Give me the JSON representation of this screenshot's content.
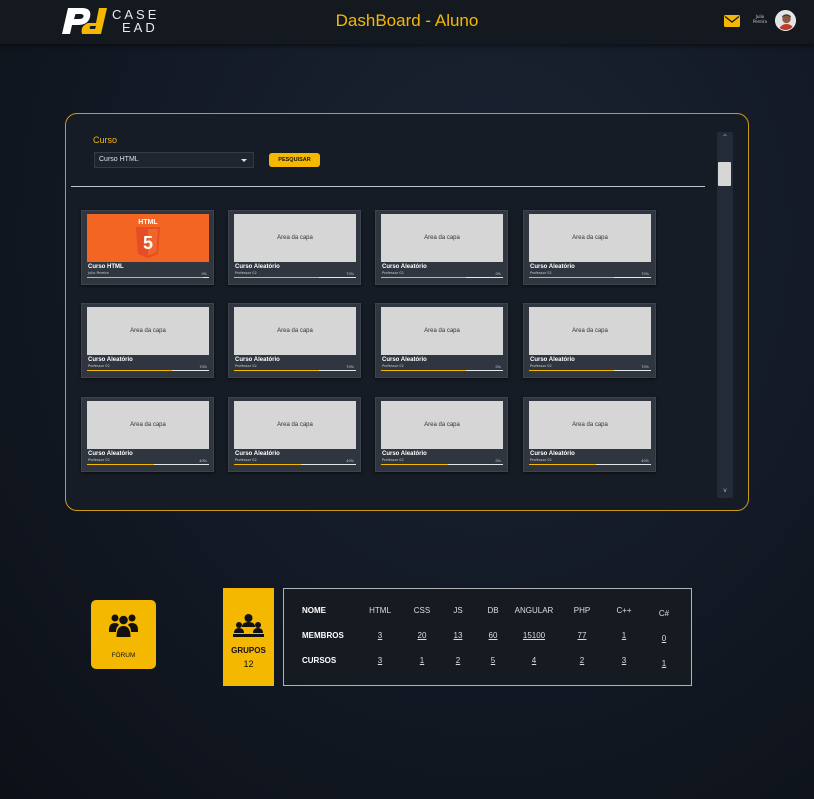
{
  "header": {
    "logo_text_line1": "CASE",
    "logo_text_line2": "EAD",
    "title": "DashBoard - Aluno",
    "user_name_line1": "Julio",
    "user_name_line2": "Pereira",
    "accent_color": "#f5b800"
  },
  "course_panel": {
    "label": "Curso",
    "select_value": "Curso HTML",
    "search_label": "PESQUISAR",
    "scroll_up": "^",
    "scroll_down": "v",
    "cards": [
      {
        "cover": "HTML",
        "title": "Curso HTML",
        "teacher": "Julio Pereira",
        "pct": "0%",
        "progress": 0.95
      },
      {
        "cover": "Area da capa",
        "title": "Curso Aleatório",
        "teacher": "Professor 02",
        "pct": "70%",
        "progress": 0.7
      },
      {
        "cover": "Area da capa",
        "title": "Curso Aleatório",
        "teacher": "Professor 02",
        "pct": "0%",
        "progress": 0.7
      },
      {
        "cover": "Area da capa",
        "title": "Curso Aleatório",
        "teacher": "Professor 02",
        "pct": "70%",
        "progress": 0.7
      },
      {
        "cover": "Area da capa",
        "title": "Curso Aleatório",
        "teacher": "Professor 02",
        "pct": "70%",
        "progress": 0.7
      },
      {
        "cover": "Area da capa",
        "title": "Curso Aleatório",
        "teacher": "Professor 02",
        "pct": "70%",
        "progress": 0.7
      },
      {
        "cover": "Area da capa",
        "title": "Curso Aleatório",
        "teacher": "Professor 02",
        "pct": "0%",
        "progress": 0.7
      },
      {
        "cover": "Area da capa",
        "title": "Curso Aleatório",
        "teacher": "Professor 02",
        "pct": "70%",
        "progress": 0.7
      },
      {
        "cover": "Area da capa",
        "title": "Curso Aleatório",
        "teacher": "Professor 02",
        "pct": "40%",
        "progress": 0.55
      },
      {
        "cover": "Area da capa",
        "title": "Curso Aleatório",
        "teacher": "Professor 02",
        "pct": "40%",
        "progress": 0.55
      },
      {
        "cover": "Area da capa",
        "title": "Curso Aleatório",
        "teacher": "Professor 02",
        "pct": "0%",
        "progress": 0.55
      },
      {
        "cover": "Area da capa",
        "title": "Curso Aleatório",
        "teacher": "Professor 02",
        "pct": "40%",
        "progress": 0.55
      }
    ]
  },
  "forum": {
    "label": "FÓRUM"
  },
  "groups": {
    "label": "GRUPOS",
    "count": "12"
  },
  "stats": {
    "columns": [
      "NOME",
      "HTML",
      "CSS",
      "JS",
      "DB",
      "ANGULAR",
      "PHP",
      "C++",
      "C#"
    ],
    "rows": [
      {
        "label": "MEMBROS",
        "values": [
          "3",
          "20",
          "13",
          "60",
          "15100",
          "77",
          "1",
          "0"
        ]
      },
      {
        "label": "CURSOS",
        "values": [
          "3",
          "1",
          "2",
          "5",
          "4",
          "2",
          "3",
          "1"
        ]
      }
    ]
  }
}
